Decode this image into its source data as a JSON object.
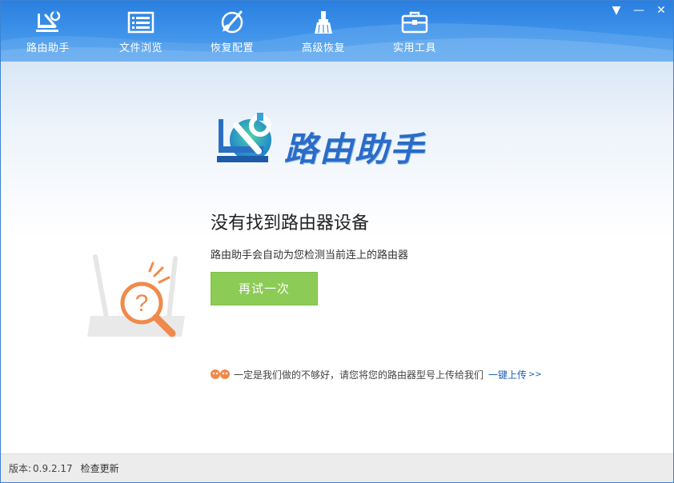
{
  "toolbar": {
    "items": [
      {
        "label": "路由助手",
        "icon": "router-wrench-icon"
      },
      {
        "label": "文件浏览",
        "icon": "file-list-icon"
      },
      {
        "label": "恢复配置",
        "icon": "paint-brush-icon"
      },
      {
        "label": "高级恢复",
        "icon": "broom-icon"
      },
      {
        "label": "实用工具",
        "icon": "toolbox-icon"
      }
    ]
  },
  "window_controls": {
    "menu": "▼",
    "minimize": "—",
    "close": "✕"
  },
  "logo": {
    "text": "路由助手",
    "icon": "router-wrench-logo-icon"
  },
  "status": {
    "title": "没有找到路由器设备",
    "subtitle": "路由助手会自动为您检测当前连上的路由器",
    "retry_label": "再试一次"
  },
  "feedback": {
    "text": "一定是我们做的不够好，请您将您的路由器型号上传给我们",
    "link": "一键上传",
    "arrow": ">>"
  },
  "footer": {
    "version_label": "版本:",
    "version_value": "0.9.2.17",
    "update_link": "检查更新"
  },
  "colors": {
    "header": "#3f93ea",
    "retry_button": "#8ccb55",
    "accent_orange": "#f08a4b",
    "link": "#1a5fb4"
  }
}
